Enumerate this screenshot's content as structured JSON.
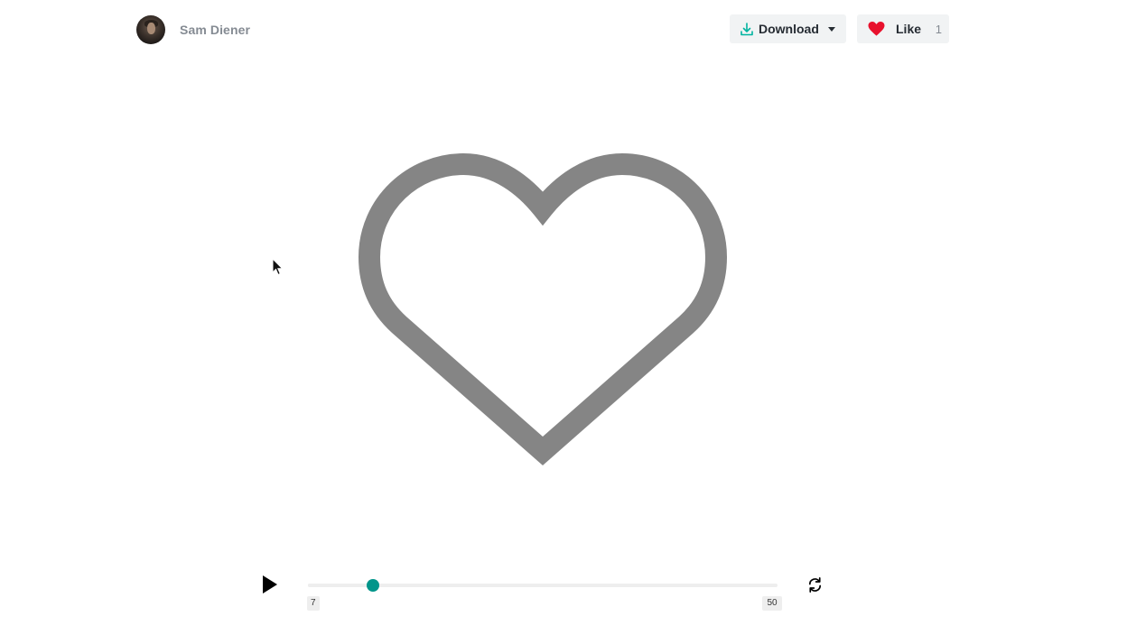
{
  "header": {
    "author_name": "Sam Diener",
    "avatar_icon": "author-avatar",
    "download": {
      "label": "Download",
      "icon": "download-icon",
      "icon_color": "#00b4a0"
    },
    "like": {
      "label": "Like",
      "count": "1",
      "icon": "heart-icon",
      "icon_color": "#e8112d"
    }
  },
  "animation": {
    "subject": "heart-outline",
    "stroke_color": "#858585"
  },
  "player": {
    "play_icon": "play-icon",
    "loop_icon": "loop-icon",
    "frame_start": "7",
    "frame_end": "50",
    "progress_fraction": 0.138,
    "accent": "#00958a"
  }
}
